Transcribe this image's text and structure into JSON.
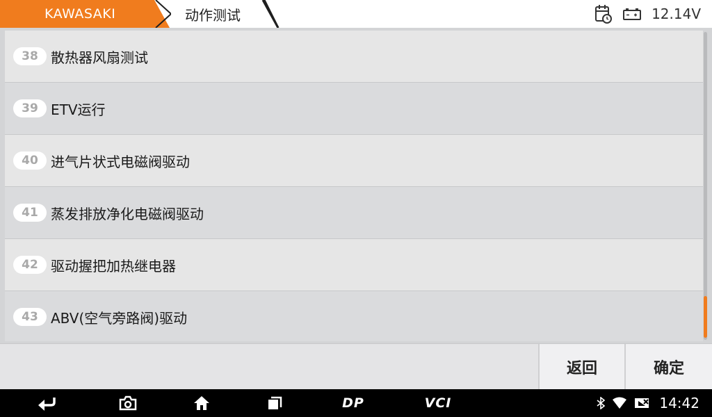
{
  "header": {
    "brand": "KAWASAKI",
    "page_title": "动作测试",
    "voltage": "12.14V",
    "brand_color": "#f07c1e"
  },
  "list": {
    "items": [
      {
        "num": "38",
        "label": "散热器风扇测试"
      },
      {
        "num": "39",
        "label": "ETV运行"
      },
      {
        "num": "40",
        "label": "进气片状式电磁阀驱动"
      },
      {
        "num": "41",
        "label": "蒸发排放净化电磁阀驱动"
      },
      {
        "num": "42",
        "label": "驱动握把加热继电器"
      },
      {
        "num": "43",
        "label": "ABV(空气旁路阀)驱动"
      }
    ],
    "scroll_position": 0.92
  },
  "buttons": {
    "back": "返回",
    "ok": "确定"
  },
  "navbar": {
    "dp_label": "DP",
    "vci_label": "VCI",
    "time": "14:42",
    "icons": [
      "back-icon",
      "camera-icon",
      "home-icon",
      "recents-icon",
      "bluetooth-icon",
      "wifi-icon",
      "signal-icon"
    ]
  }
}
